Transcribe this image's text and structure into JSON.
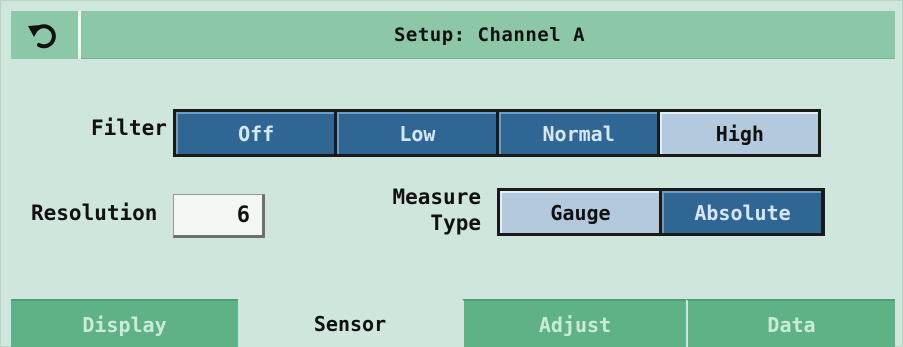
{
  "header": {
    "title": "Setup: Channel A",
    "back_icon": "undo-arrow-icon"
  },
  "filter": {
    "label": "Filter",
    "options": [
      "Off",
      "Low",
      "Normal",
      "High"
    ],
    "selected": "High"
  },
  "resolution": {
    "label": "Resolution",
    "value": "6"
  },
  "measure_type": {
    "label_line1": "Measure",
    "label_line2": "Type",
    "options": [
      "Gauge",
      "Absolute"
    ],
    "selected": "Gauge"
  },
  "tabs": [
    {
      "label": "Display"
    },
    {
      "label": "Sensor"
    },
    {
      "label": "Adjust"
    },
    {
      "label": "Data"
    }
  ],
  "active_tab": "Sensor",
  "colors": {
    "background": "#cfe6dc",
    "header": "#8cc7a7",
    "segment_unselected": "#2f6694",
    "segment_selected": "#b3c9dd",
    "tab_inactive": "#5fb186"
  }
}
